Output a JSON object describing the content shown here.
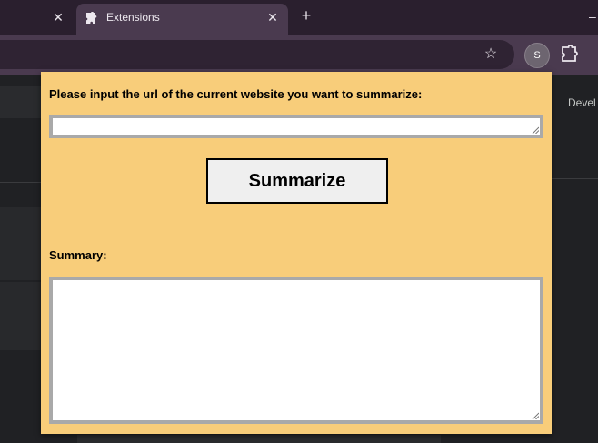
{
  "browser": {
    "tabs": [
      {
        "label": "",
        "close": "✕"
      },
      {
        "label": "Extensions",
        "close": "✕"
      }
    ],
    "new_tab": "+",
    "window_minimize": "–",
    "toolbar": {
      "bookmark_star": "☆",
      "profile_initial": "S"
    }
  },
  "background_page": {
    "partial_text": "Devel"
  },
  "popup": {
    "prompt_label": "Please input the url of the current website you want to summarize:",
    "url_input": {
      "value": "",
      "placeholder": ""
    },
    "summarize_button": "Summarize",
    "summary_label": "Summary:",
    "summary_output": {
      "value": ""
    },
    "colors": {
      "background": "#f8cd7a",
      "field_border": "#a9a9a9",
      "button_bg": "#efefef"
    }
  },
  "colors": {
    "tabstrip": "#2a1f2e",
    "toolbar": "#4a3a4f",
    "page": "#202124"
  }
}
